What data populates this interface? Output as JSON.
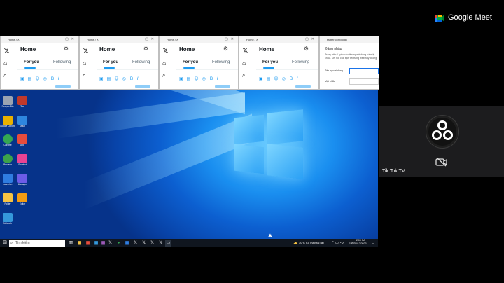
{
  "meet": {
    "brand": "Google Meet"
  },
  "participant": {
    "name": "Tik Tok TV",
    "camera_status": "camera-off"
  },
  "browser_windows": [
    {
      "title": "Home / X",
      "home_label": "Home",
      "tab_for_you": "For you",
      "tab_following": "Following"
    },
    {
      "title": "Home / X",
      "home_label": "Home",
      "tab_for_you": "For you",
      "tab_following": "Following"
    },
    {
      "title": "Home / X",
      "home_label": "Home",
      "tab_for_you": "For you",
      "tab_following": "Following"
    },
    {
      "title": "Home / X",
      "home_label": "Home",
      "tab_for_you": "For you",
      "tab_following": "Following"
    }
  ],
  "login_window": {
    "url": "twitter.com/login",
    "heading": "Đăng nhập",
    "message": "Proxy http://..yêu cầu tên người dùng và mật khẩu. Kết nối của bạn tới trang web này không bảo mật",
    "username_label": "Tên người dùng",
    "password_label": "Mật khẩu"
  },
  "taskbar": {
    "search_placeholder": "Tìm kiếm",
    "weather": "30°C Có mây rải rác",
    "language": "ENG",
    "time": "2:09 SA",
    "date": "20/12/2023"
  },
  "desktop_icons": [
    {
      "label": "Recycle Bin",
      "color": "#9aa4b2"
    },
    {
      "label": "Tool",
      "color": "#c0392b"
    },
    {
      "label": "Google Chrome",
      "color": "#e8b000"
    },
    {
      "label": "Setup",
      "color": "#2e86de"
    },
    {
      "label": "Chrome",
      "color": "#34a853"
    },
    {
      "label": "App",
      "color": "#e74c3c"
    },
    {
      "label": "Browser",
      "color": "#3ca34b"
    },
    {
      "label": "Shortcut",
      "color": "#e84393"
    },
    {
      "label": "Launcher",
      "color": "#2f7de1"
    },
    {
      "label": "Manager",
      "color": "#6c5ce7"
    },
    {
      "label": "Folder",
      "color": "#f6c343"
    },
    {
      "label": "Editor",
      "color": "#f39c12"
    },
    {
      "label": "Network",
      "color": "#3498db"
    }
  ]
}
